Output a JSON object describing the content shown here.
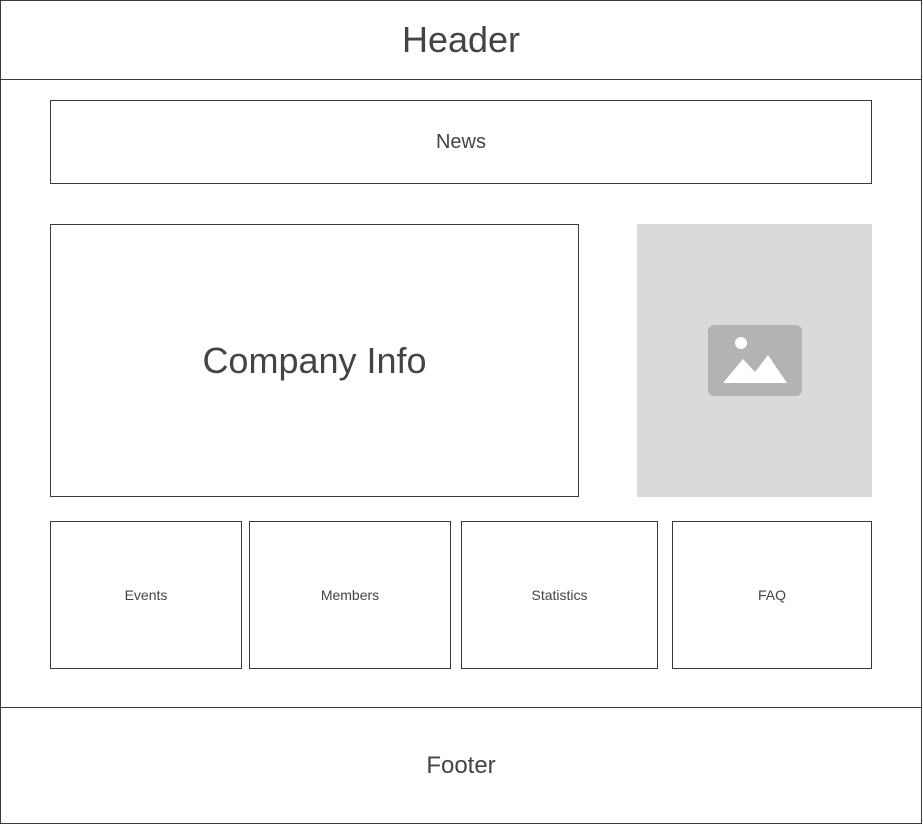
{
  "header": {
    "label": "Header"
  },
  "news": {
    "label": "News"
  },
  "company_info": {
    "label": "Company Info"
  },
  "image_placeholder": {
    "icon": "image-icon",
    "background": "#dadada",
    "icon_color": "#b3b3b3"
  },
  "tiles": [
    {
      "label": "Events"
    },
    {
      "label": "Members"
    },
    {
      "label": "Statistics"
    },
    {
      "label": "FAQ"
    }
  ],
  "footer": {
    "label": "Footer"
  }
}
